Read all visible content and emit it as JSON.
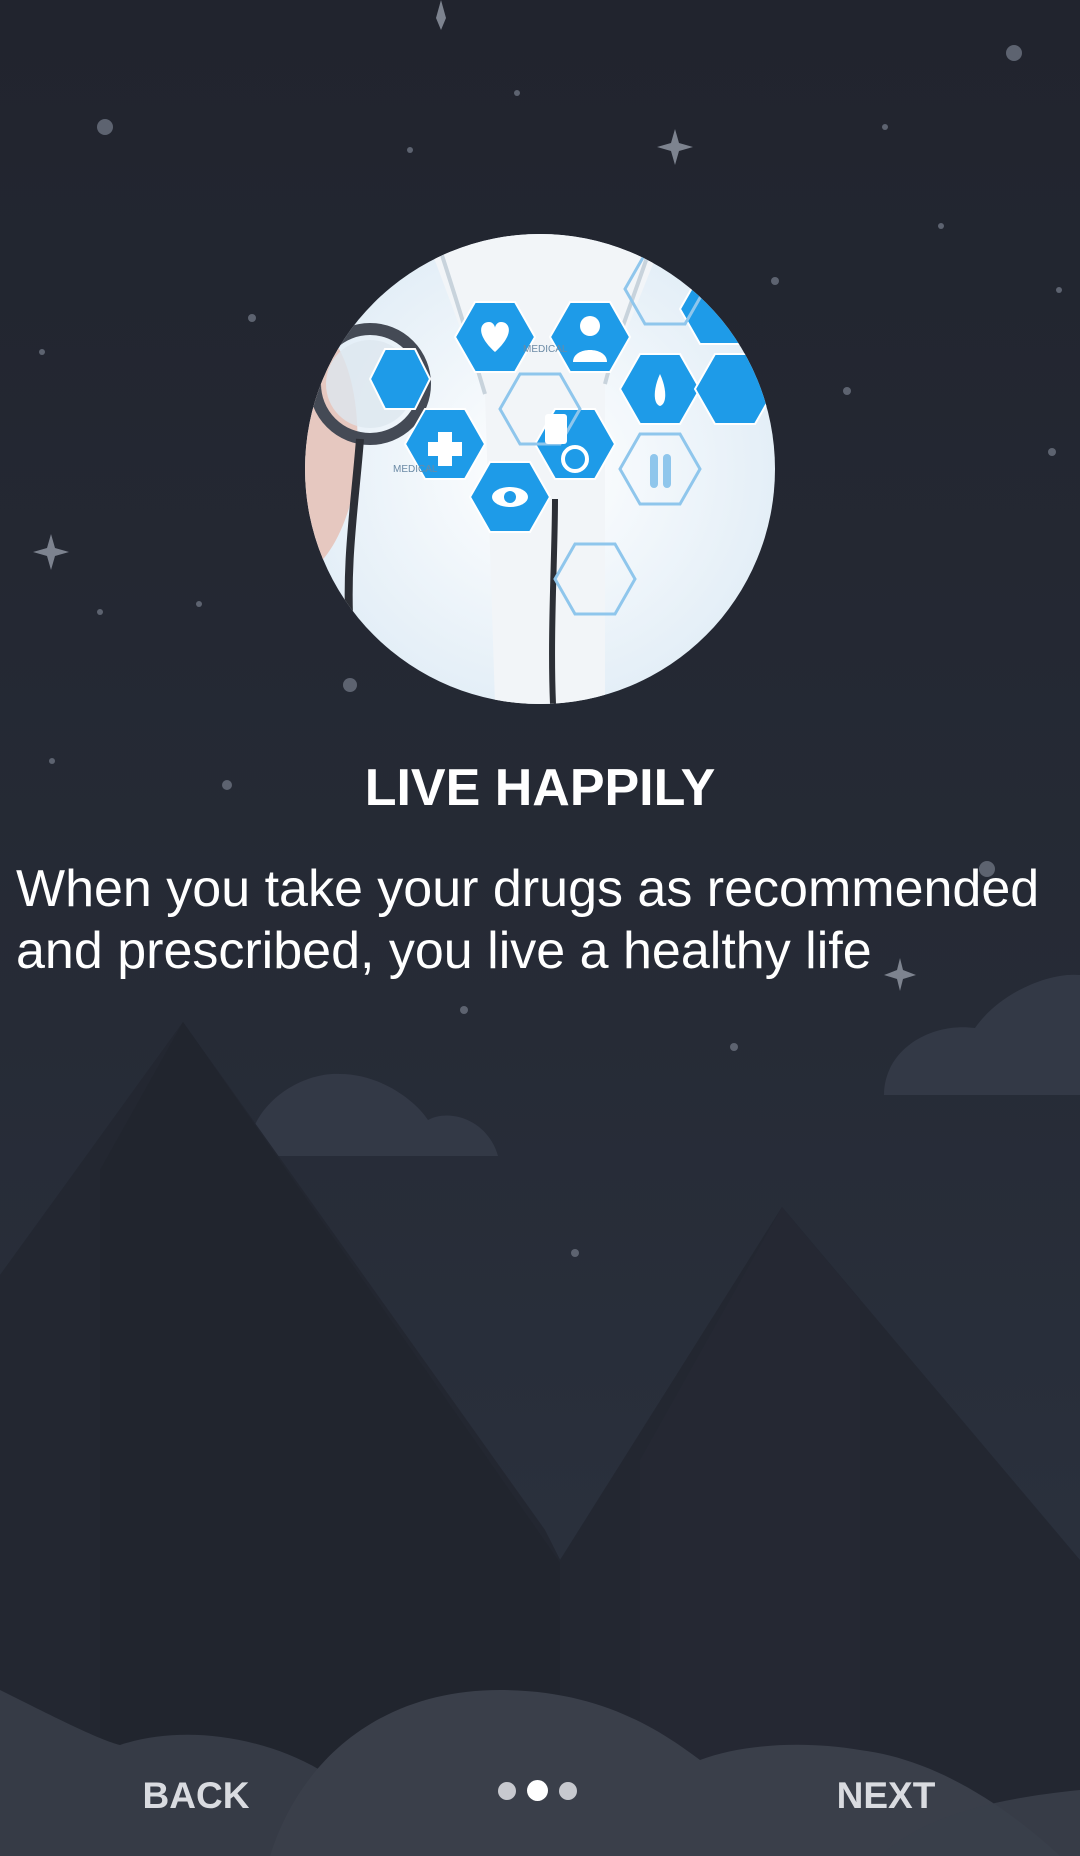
{
  "onboarding": {
    "title": "LIVE HAPPILY",
    "description": "When you take your drugs as recommended and prescribed, you live a healthy life",
    "hero_image": {
      "label_1": "MEDICAL",
      "label_2": "MEDICAL",
      "icon": "medical-hexagon-icons"
    }
  },
  "navigation": {
    "back_label": "BACK",
    "next_label": "NEXT",
    "page_count": 3,
    "current_page": 2
  },
  "colors": {
    "background": "#232733",
    "accent_blue": "#1e9be8",
    "text": "#ffffff"
  }
}
